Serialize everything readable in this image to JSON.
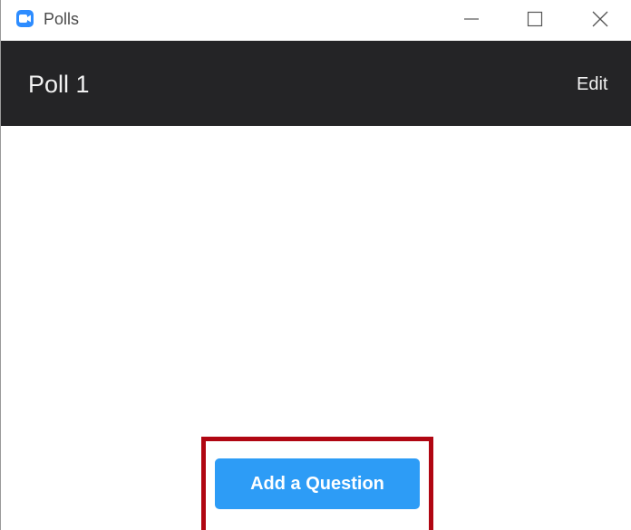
{
  "window": {
    "title": "Polls",
    "icon": "zoom-camera-icon"
  },
  "header": {
    "poll_title": "Poll 1",
    "edit_label": "Edit"
  },
  "main": {
    "add_question_label": "Add a Question"
  },
  "colors": {
    "accent": "#2d9cf6",
    "header_bg": "#242426",
    "highlight": "#b00612",
    "app_icon": "#2d8cff"
  }
}
